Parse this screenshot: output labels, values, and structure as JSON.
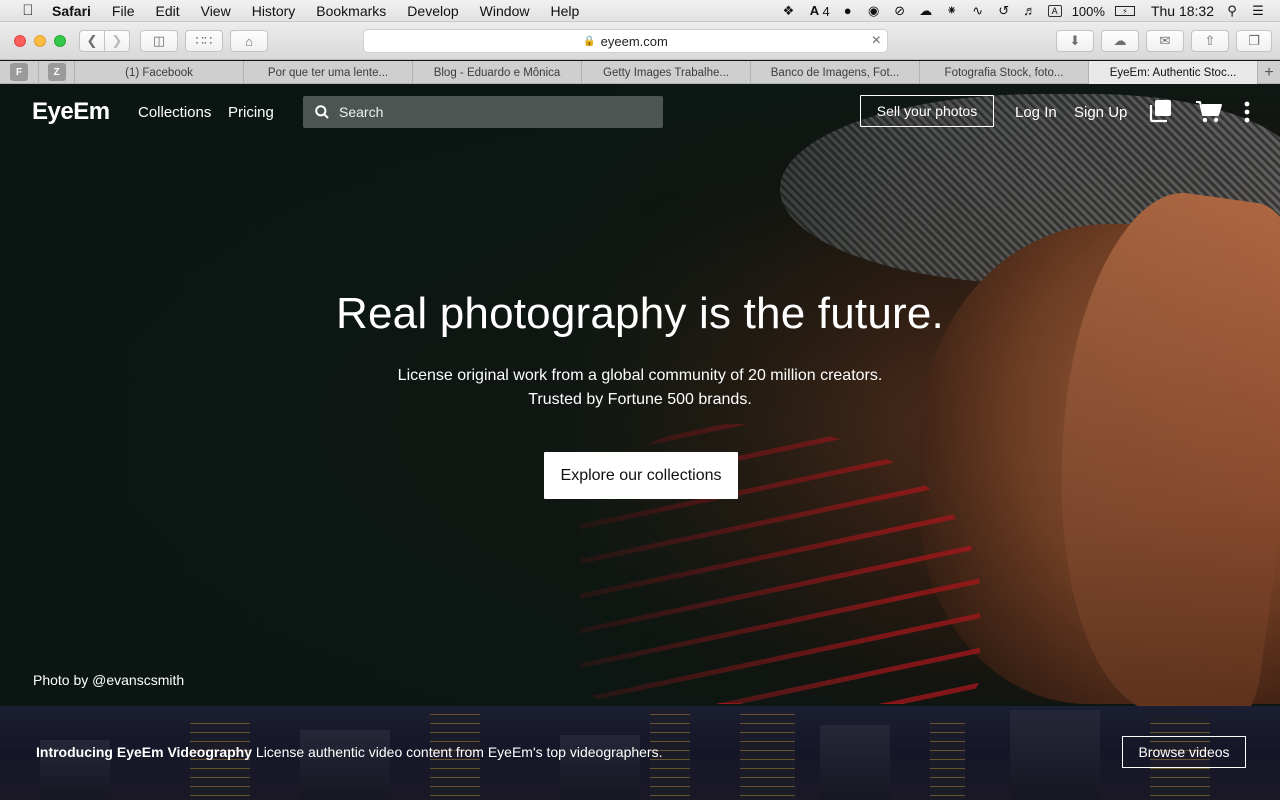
{
  "menubar": {
    "apple_icon": "apple-icon",
    "app_name": "Safari",
    "items": [
      "File",
      "Edit",
      "View",
      "History",
      "Bookmarks",
      "Develop",
      "Window",
      "Help"
    ],
    "adobe_count": "4",
    "battery": "100%",
    "clock": "Thu 18:32"
  },
  "browser": {
    "url": "eyeem.com"
  },
  "tabs": {
    "pinned": [
      "F",
      "Z"
    ],
    "items": [
      "(1) Facebook",
      "Por que ter uma lente...",
      "Blog - Eduardo e Mônica",
      "Getty Images Trabalhe...",
      "Banco de Imagens, Fot...",
      "Fotografia Stock, foto...",
      "EyeEm: Authentic Stoc..."
    ],
    "active_index": 6
  },
  "site": {
    "logo": "EyeEm",
    "nav_collections": "Collections",
    "nav_pricing": "Pricing",
    "search_placeholder": "Search",
    "sell_button": "Sell your photos",
    "login": "Log In",
    "signup": "Sign Up"
  },
  "hero": {
    "headline": "Real photography is the future.",
    "sub_line1": "License original work from a global community of 20 million creators.",
    "sub_line2": "Trusted by Fortune 500 brands.",
    "cta": "Explore our collections",
    "credit": "Photo by @evanscsmith"
  },
  "video_banner": {
    "title": "Introducing EyeEm Videography",
    "text": " License authentic video content from EyeEm's top videographers.",
    "button": "Browse videos"
  },
  "colors": {
    "accent_red": "#c4161c",
    "hero_bg": "#0c1713"
  }
}
